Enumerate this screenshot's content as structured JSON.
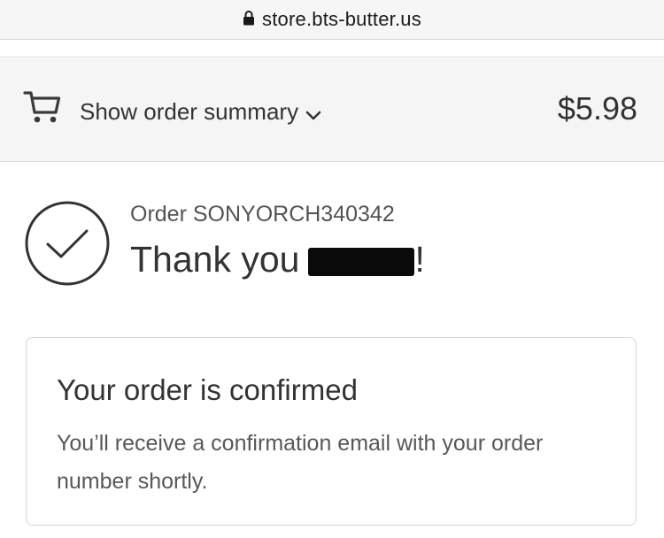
{
  "browser": {
    "url": "store.bts-butter.us",
    "lock_icon": "lock-icon"
  },
  "order_summary": {
    "cart_icon": "shopping-cart-icon",
    "toggle_label": "Show order summary",
    "chevron_icon": "chevron-down-icon",
    "total": "$5.98"
  },
  "confirmation": {
    "status_icon": "checkmark-circle-icon",
    "order_number": "Order SONYORCH340342",
    "thank_you_prefix": "Thank you",
    "thank_you_suffix": "!",
    "name_redacted": true
  },
  "card": {
    "title": "Your order is confirmed",
    "body": "You’ll receive a confirmation email with your order number shortly."
  },
  "colors": {
    "text": "#333333",
    "muted": "#545454",
    "summary_bg": "#f5f5f5",
    "border": "#d4d4d4"
  }
}
